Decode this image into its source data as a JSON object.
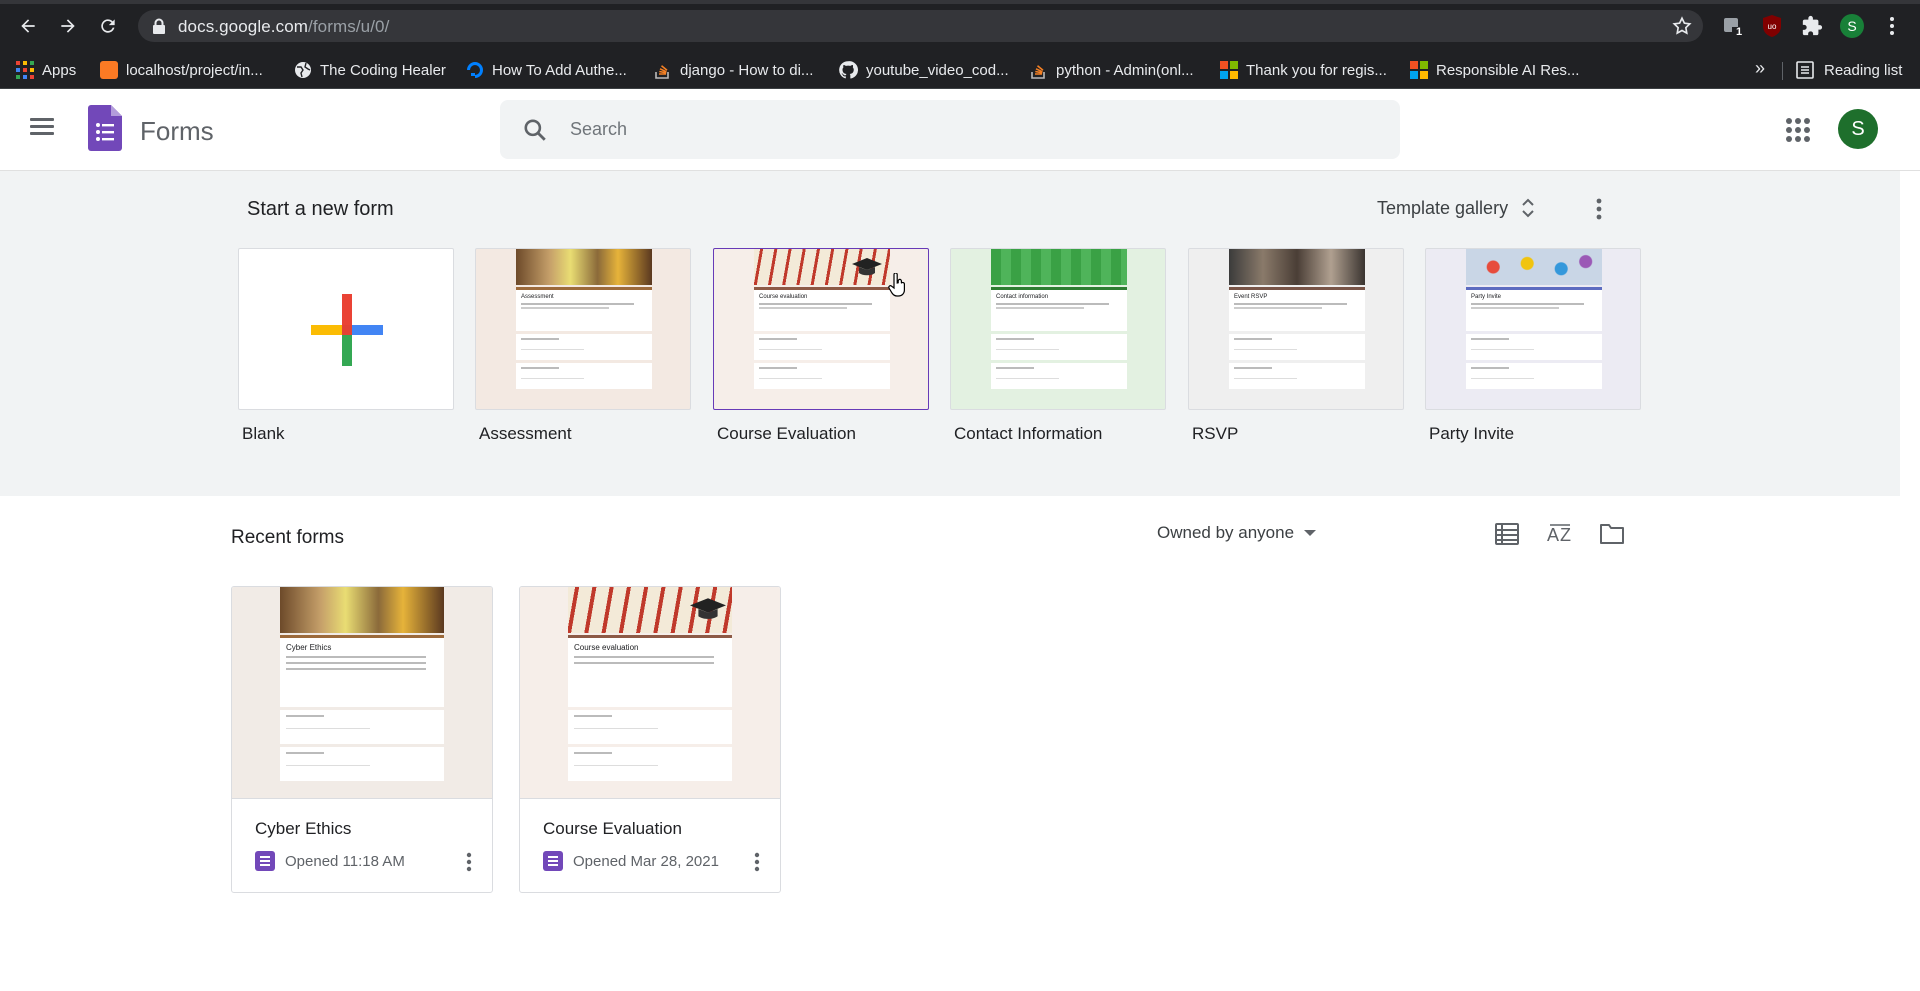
{
  "browser": {
    "url_host": "docs.google.com",
    "url_path": "/forms/u/0/",
    "extension_badge": "1",
    "profile_initial": "S"
  },
  "bookmarks": [
    {
      "label": "Apps",
      "icon": "apps-grid-icon"
    },
    {
      "label": "localhost/project/in...",
      "icon": "xampp-icon"
    },
    {
      "label": "The Coding Healer",
      "icon": "globe-icon"
    },
    {
      "label": "How To Add Authe...",
      "icon": "digitalocean-icon"
    },
    {
      "label": "django - How to di...",
      "icon": "stackoverflow-icon"
    },
    {
      "label": "youtube_video_cod...",
      "icon": "github-icon"
    },
    {
      "label": "python - Admin(onl...",
      "icon": "stackoverflow-icon"
    },
    {
      "label": "Thank you for regis...",
      "icon": "microsoft-icon"
    },
    {
      "label": "Responsible AI Res...",
      "icon": "microsoft-icon"
    }
  ],
  "reading_list_label": "Reading list",
  "app": {
    "title": "Forms",
    "search_placeholder": "Search",
    "avatar_initial": "S"
  },
  "new_form": {
    "heading": "Start a new form",
    "template_gallery_label": "Template gallery",
    "templates": [
      {
        "name": "Blank"
      },
      {
        "name": "Assessment",
        "mini_title": "Assessment"
      },
      {
        "name": "Course Evaluation",
        "mini_title": "Course evaluation"
      },
      {
        "name": "Contact Information",
        "mini_title": "Contact information"
      },
      {
        "name": "RSVP",
        "mini_title": "Event RSVP"
      },
      {
        "name": "Party Invite",
        "mini_title": "Party Invite"
      }
    ]
  },
  "recent": {
    "heading": "Recent forms",
    "owner_filter": "Owned by anyone",
    "forms": [
      {
        "name": "Cyber Ethics",
        "mini_title": "Cyber Ethics",
        "opened": "Opened 11:18 AM"
      },
      {
        "name": "Course Evaluation",
        "mini_title": "Course evaluation",
        "opened": "Opened Mar 28, 2021"
      }
    ]
  },
  "colors": {
    "forms_purple": "#673ab7",
    "chrome_dark": "#202124",
    "section_bg": "#f1f3f4"
  }
}
